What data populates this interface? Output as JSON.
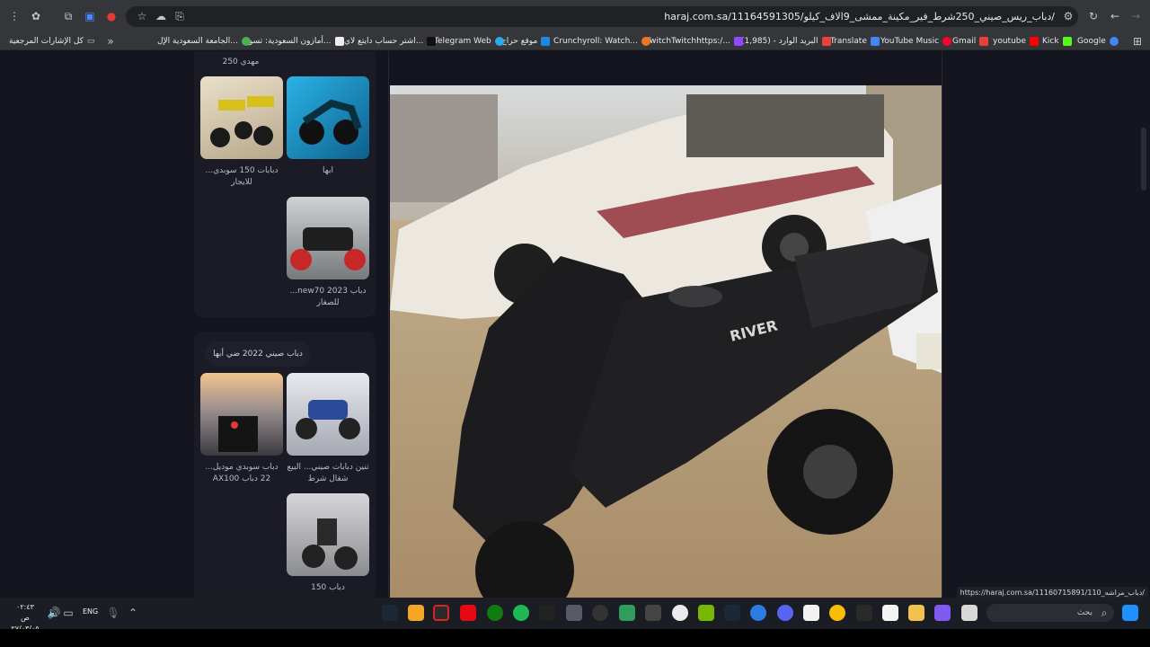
{
  "browser": {
    "url": "haraj.com.sa/11164591305/دباب_ريس_صيني_250شرط_فير_مكينة_ممشى_9الاف_كيلو/",
    "bookmarks": [
      {
        "label": "Google",
        "color": "#4285f4"
      },
      {
        "label": "Kick",
        "color": "#53fc18"
      },
      {
        "label": "youtube",
        "color": "#ff0000"
      },
      {
        "label": "Gmail",
        "color": "#ea4335"
      },
      {
        "label": "YouTube Music",
        "color": "#ff0033"
      },
      {
        "label": "Translate",
        "color": "#4285f4"
      },
      {
        "label": "(1,985) - البريد الوارد",
        "color": "#ea4335"
      },
      {
        "label": "TwitchTwitchhttps:/...",
        "color": "#9146ff"
      },
      {
        "label": "Crunchyroll: Watch...",
        "color": "#f47521"
      },
      {
        "label": "موقع حراج",
        "color": "#1e88e5"
      },
      {
        "label": "Telegram Web",
        "color": "#2aabee"
      },
      {
        "label": "اشتر حساب دايتع لاي...",
        "color": "#111111"
      },
      {
        "label": "أمازون السعودية: تسو...",
        "color": "#eeeeee"
      },
      {
        "label": "الجامعة السعودية الإل...",
        "color": "#4caf50"
      }
    ],
    "all_bookmarks": "كل الإشارات المرجعية",
    "status_url": "https://haraj.com.sa/11160715891/110_دباب_مراشه/"
  },
  "sidebar": {
    "top_caption": "مهدي 250",
    "listings": [
      {
        "caption": "ابها",
        "image": "blue-scooter"
      },
      {
        "caption": "دبابات 150 سوبدي... للايجار",
        "image": "yellow-bikes"
      },
      {
        "caption": "دباب 2023 new70... للصغار",
        "image": "quad-red"
      }
    ],
    "section_title": "دباب صيني 2022 ضي أبها",
    "listings2": [
      {
        "caption": "تنين دبابات صيني... البيع شغال شرط",
        "image": "quad-blue"
      },
      {
        "caption": "دباب سوبدي موديل... 22 دباب AX100",
        "image": "sunset-bike"
      },
      {
        "caption": "دباب 150",
        "image": "cruiser"
      }
    ]
  },
  "taskbar": {
    "time": "٠٢:٤٣ ص",
    "date": "٢٧/٠٣/٠٥",
    "language": "ENG",
    "search_placeholder": "بحث"
  }
}
